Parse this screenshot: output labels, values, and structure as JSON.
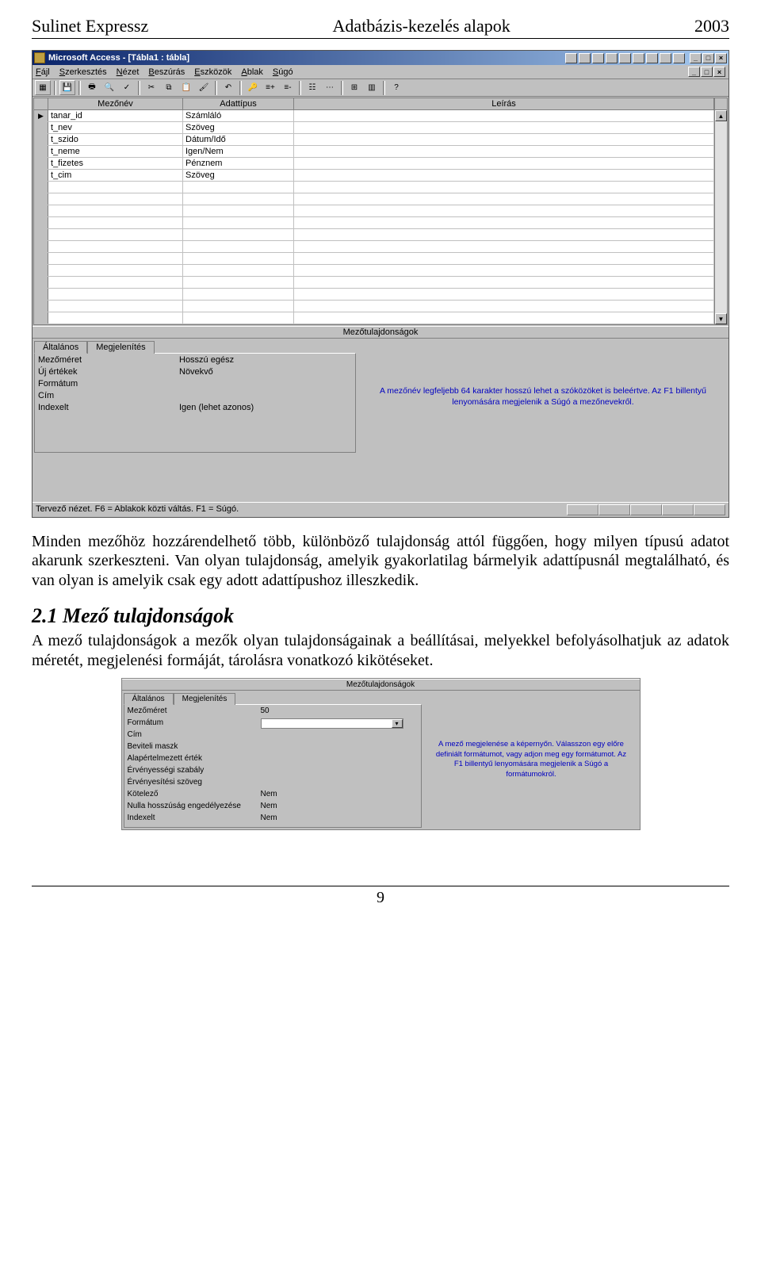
{
  "header": {
    "left": "Sulinet Expressz",
    "center": "Adatbázis-kezelés alapok",
    "right": "2003"
  },
  "ss1": {
    "title": "Microsoft Access - [Tábla1 : tábla]",
    "menus": [
      "Fájl",
      "Szerkesztés",
      "Nézet",
      "Beszúrás",
      "Eszközök",
      "Ablak",
      "Súgó"
    ],
    "cols": [
      "Mezőnév",
      "Adattípus",
      "Leírás"
    ],
    "rows": [
      {
        "marker": "▶",
        "name": "tanar_id",
        "type": "Számláló",
        "desc": ""
      },
      {
        "marker": "",
        "name": "t_nev",
        "type": "Szöveg",
        "desc": ""
      },
      {
        "marker": "",
        "name": "t_szido",
        "type": "Dátum/Idő",
        "desc": ""
      },
      {
        "marker": "",
        "name": "t_neme",
        "type": "Igen/Nem",
        "desc": ""
      },
      {
        "marker": "",
        "name": "t_fizetes",
        "type": "Pénznem",
        "desc": ""
      },
      {
        "marker": "",
        "name": "t_cim",
        "type": "Szöveg",
        "desc": ""
      }
    ],
    "blankRowCount": 12,
    "section_label": "Mezőtulajdonságok",
    "tabs": [
      "Általános",
      "Megjelenítés"
    ],
    "props": [
      {
        "label": "Mezőméret",
        "value": "Hosszú egész"
      },
      {
        "label": "Új értékek",
        "value": "Növekvő"
      },
      {
        "label": "Formátum",
        "value": ""
      },
      {
        "label": "Cím",
        "value": ""
      },
      {
        "label": "Indexelt",
        "value": "Igen (lehet azonos)"
      }
    ],
    "hint": "A mezőnév legfeljebb 64 karakter hosszú lehet a szóközöket is beleértve. Az F1 billentyű lenyomására megjelenik a Súgó a mezőnevekről.",
    "status": "Tervező nézet. F6 = Ablakok közti váltás. F1 = Súgó."
  },
  "para1": "Minden mezőhöz hozzárendelhető több, különböző tulajdonság attól függően, hogy milyen típusú adatot akarunk szerkeszteni. Van olyan tulajdonság, amelyik gyakorlatilag bármelyik adattípusnál megtalálható, és van olyan is amelyik csak egy adott adattípushoz illeszkedik.",
  "h2": "2.1 Mező tulajdonságok",
  "para2": "A mező tulajdonságok a mezők olyan tulajdonságainak a beállításai, melyekkel befolyásolhatjuk az adatok méretét, megjelenési formáját, tárolásra vonatkozó kikötéseket.",
  "ss2": {
    "section_label": "Mezőtulajdonságok",
    "tabs": [
      "Általános",
      "Megjelenítés"
    ],
    "props": [
      {
        "label": "Mezőméret",
        "value": "50"
      },
      {
        "label": "Formátum",
        "value": ""
      },
      {
        "label": "Cím",
        "value": ""
      },
      {
        "label": "Beviteli maszk",
        "value": ""
      },
      {
        "label": "Alapértelmezett érték",
        "value": ""
      },
      {
        "label": "Érvényességi szabály",
        "value": ""
      },
      {
        "label": "Érvényesítési szöveg",
        "value": ""
      },
      {
        "label": "Kötelező",
        "value": "Nem"
      },
      {
        "label": "Nulla hosszúság engedélyezése",
        "value": "Nem"
      },
      {
        "label": "Indexelt",
        "value": "Nem"
      }
    ],
    "hint": "A mező megjelenése a képernyőn. Válasszon egy előre definiált formátumot, vagy adjon meg egy formátumot. Az F1 billentyű lenyomására megjelenik a Súgó a formátumokról."
  },
  "page_num": "9"
}
